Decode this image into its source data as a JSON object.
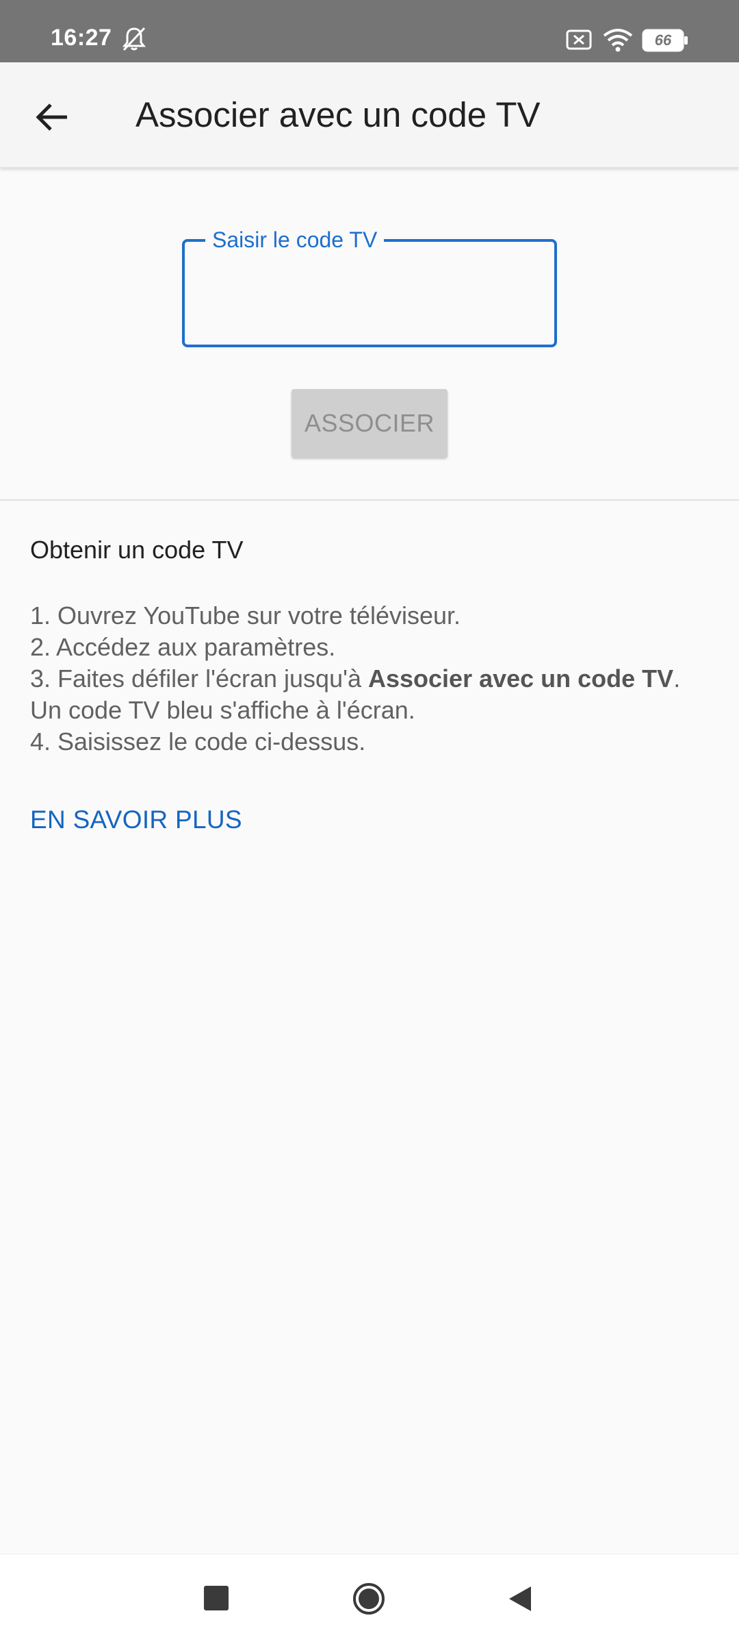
{
  "status_bar": {
    "time": "16:27",
    "battery_level": "66",
    "icons": [
      "bell-off-icon",
      "sim-x-icon",
      "wifi-icon",
      "battery-icon"
    ]
  },
  "app_bar": {
    "title": "Associer avec un code TV",
    "back_icon": "arrow-left-icon"
  },
  "form": {
    "field_label": "Saisir le code TV",
    "field_value": "",
    "submit_label": "ASSOCIER"
  },
  "help": {
    "heading": "Obtenir un code TV",
    "steps": {
      "s1": "1. Ouvrez YouTube sur votre téléviseur.",
      "s2": "2. Accédez aux paramètres.",
      "s3_prefix": "3. Faites défiler l'écran jusqu'à ",
      "s3_bold": "Associer avec un code TV",
      "s3_suffix": ".",
      "s3_line2": "Un code TV bleu s'affiche à l'écran.",
      "s4": "4. Saisissez le code ci-dessus."
    },
    "learn_more": "EN SAVOIR PLUS"
  },
  "nav_bar": {
    "icons": [
      "recents-square-icon",
      "home-circle-icon",
      "back-triangle-icon"
    ]
  },
  "colors": {
    "accent": "#1e6fcc",
    "link": "#1565c0",
    "status_bar": "#757575",
    "disabled_button": "#cfcfcf"
  }
}
